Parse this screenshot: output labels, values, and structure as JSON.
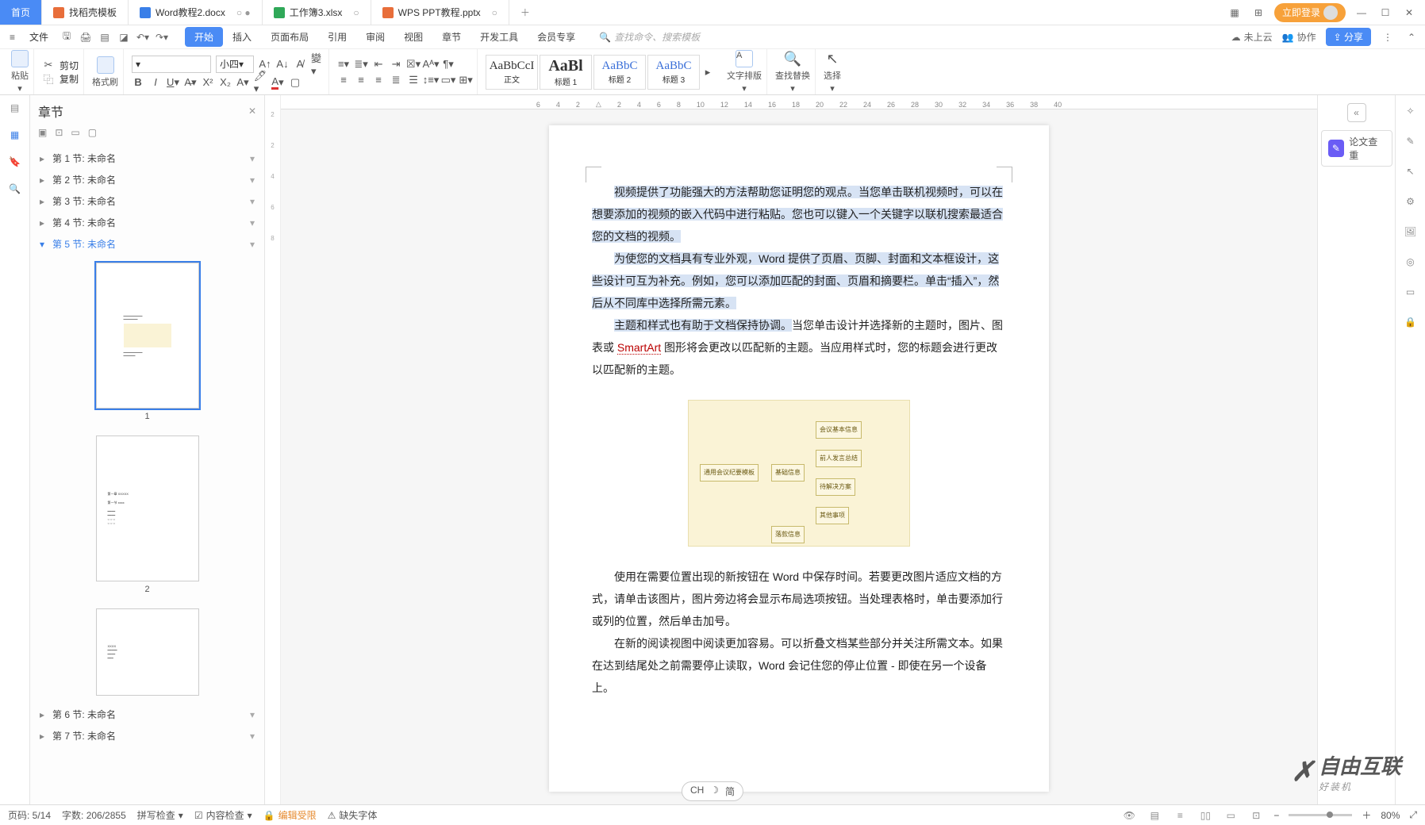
{
  "tabs": {
    "home": "首页",
    "items": [
      {
        "icon": "ic-orange",
        "label": "找稻壳模板"
      },
      {
        "icon": "ic-blue",
        "label": "Word教程2.docx",
        "active": true
      },
      {
        "icon": "ic-green",
        "label": "工作簿3.xlsx"
      },
      {
        "icon": "ic-ppt",
        "label": "WPS PPT教程.pptx"
      }
    ],
    "login": "立即登录"
  },
  "toolbar": {
    "file": "文件",
    "ribbon": [
      "开始",
      "插入",
      "页面布局",
      "引用",
      "审阅",
      "视图",
      "章节",
      "开发工具",
      "会员专享"
    ],
    "search_placeholder": "查找命令、搜索模板",
    "cloud": "未上云",
    "coop": "协作",
    "share": "分享"
  },
  "ribbon": {
    "paste": "粘贴",
    "cut": "剪切",
    "copy": "复制",
    "brush": "格式刷",
    "font_name": "",
    "font_size": "小四",
    "style_labels": [
      "正文",
      "标题 1",
      "标题 2",
      "标题 3"
    ],
    "textlayout": "文字排版",
    "findrep": "查找替换",
    "select": "选择"
  },
  "nav": {
    "title": "章节",
    "sections": [
      "第 1 节: 未命名",
      "第 2 节: 未命名",
      "第 3 节: 未命名",
      "第 4 节: 未命名",
      "第 5 节: 未命名",
      "第 6 节: 未命名",
      "第 7 节: 未命名"
    ],
    "active_index": 4,
    "thumb_nums": [
      "1",
      "2"
    ]
  },
  "ruler_marks": [
    "6",
    "4",
    "2",
    "",
    "2",
    "4",
    "6",
    "8",
    "10",
    "12",
    "14",
    "16",
    "18",
    "20",
    "22",
    "24",
    "26",
    "28",
    "30",
    "32",
    "34",
    "36",
    "38",
    "40"
  ],
  "doc": {
    "p1": "视频提供了功能强大的方法帮助您证明您的观点。当您单击联机视频时，可以在想要添加的视频的嵌入代码中进行粘贴。您也可以键入一个关键字以联机搜索最适合您的文档的视频。",
    "p2_a": "为使您的文档具有专业外观，Word 提供了页眉、页脚、封面和文本框设计，这些设计可互为补充。例如，您可以添加匹配的封面、页眉和摘要栏。单击“插入”，然后从不同库中选择所需元素。",
    "p3_a": "主题和样式也有助于文档保持协调。",
    "p3_b": "当您单击设计并选择新的主题时，图片、图表或 ",
    "p3_smart": "SmartArt",
    "p3_c": " 图形将会更改以匹配新的主题。当应用样式时，您的标题会进行更改以匹配新的主题。",
    "p4": "使用在需要位置出现的新按钮在 Word 中保存时间。若要更改图片适应文档的方式，请单击该图片，图片旁边将会显示布局选项按钮。当处理表格时，单击要添加行或列的位置，然后单击加号。",
    "p5": "在新的阅读视图中阅读更加容易。可以折叠文档某些部分并关注所需文本。如果在达到结尾处之前需要停止读取，Word 会记住您的停止位置 - 即使在另一个设备上。",
    "diagram_center": "通用会议纪要模板"
  },
  "right_panel": {
    "essay": "论文查重"
  },
  "status": {
    "page": "页码: 5/14",
    "words": "字数: 206/2855",
    "spell": "拼写检查",
    "content": "内容检查",
    "edit_limited": "编辑受限",
    "missing_font": "缺失字体",
    "zoom": "80%"
  },
  "ime": {
    "lang": "CH",
    "moon": "☽",
    "mode": "简"
  },
  "watermark": {
    "brand": "自由互联",
    "sub": "好装机"
  }
}
